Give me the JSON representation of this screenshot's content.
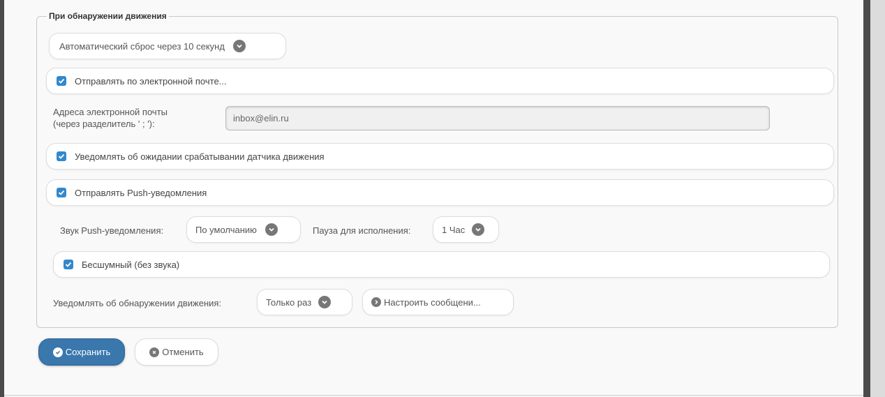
{
  "section": {
    "legend": "При обнаружении движения"
  },
  "auto_reset": {
    "value": "Автоматический сброс через 10 секунд"
  },
  "send_email": {
    "label": "Отправлять по электронной почте...",
    "checked": true
  },
  "email_addresses": {
    "label_line1": "Адреса электронной почты",
    "label_line2": "(через разделитель ' ; '):",
    "value": "inbox@elin.ru"
  },
  "notify_wait": {
    "label": "Уведомлять об ожидании срабатывании датчика движения",
    "checked": true
  },
  "send_push": {
    "label": "Отправлять Push-уведомления",
    "checked": true
  },
  "push_sound": {
    "label": "Звук Push-уведомления:",
    "value": "По умолчанию"
  },
  "pause": {
    "label": "Пауза для исполнения:",
    "value": "1 Час"
  },
  "silent": {
    "label": "Бесшумный (без звука)",
    "checked": true
  },
  "notify_detection": {
    "label": "Уведомлять об обнаружении движения:",
    "value": "Только раз",
    "configure_label": "Настроить сообщени..."
  },
  "actions": {
    "save_label": "Сохранить",
    "cancel_label": "Отменить"
  },
  "colors": {
    "accent": "#3a77ad",
    "checkbox": "#3388cc"
  }
}
